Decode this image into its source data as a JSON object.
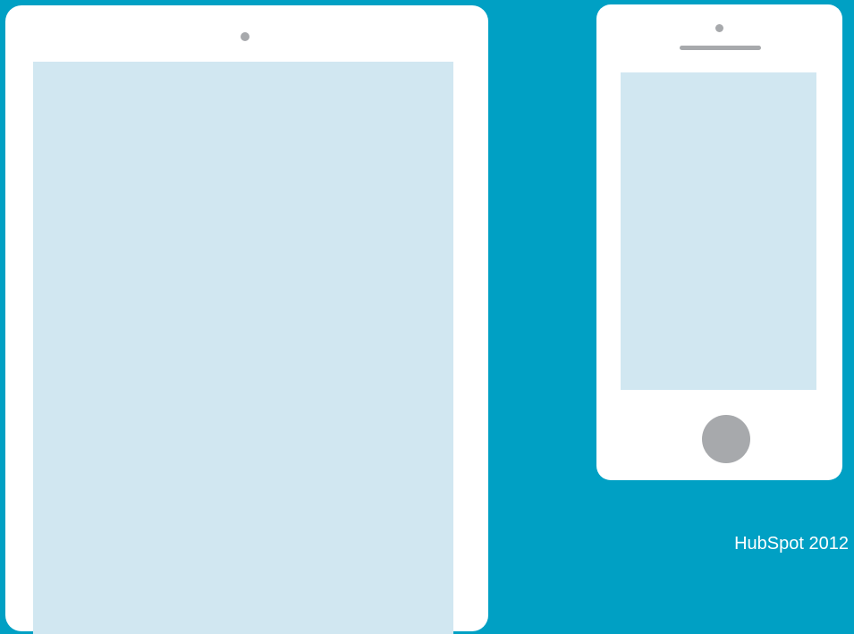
{
  "credit": {
    "text": "HubSpot 2012"
  },
  "colors": {
    "background": "#00a0c4",
    "device_body": "#ffffff",
    "screen": "#d1e7f1",
    "hardware": "#a7a9ac"
  }
}
